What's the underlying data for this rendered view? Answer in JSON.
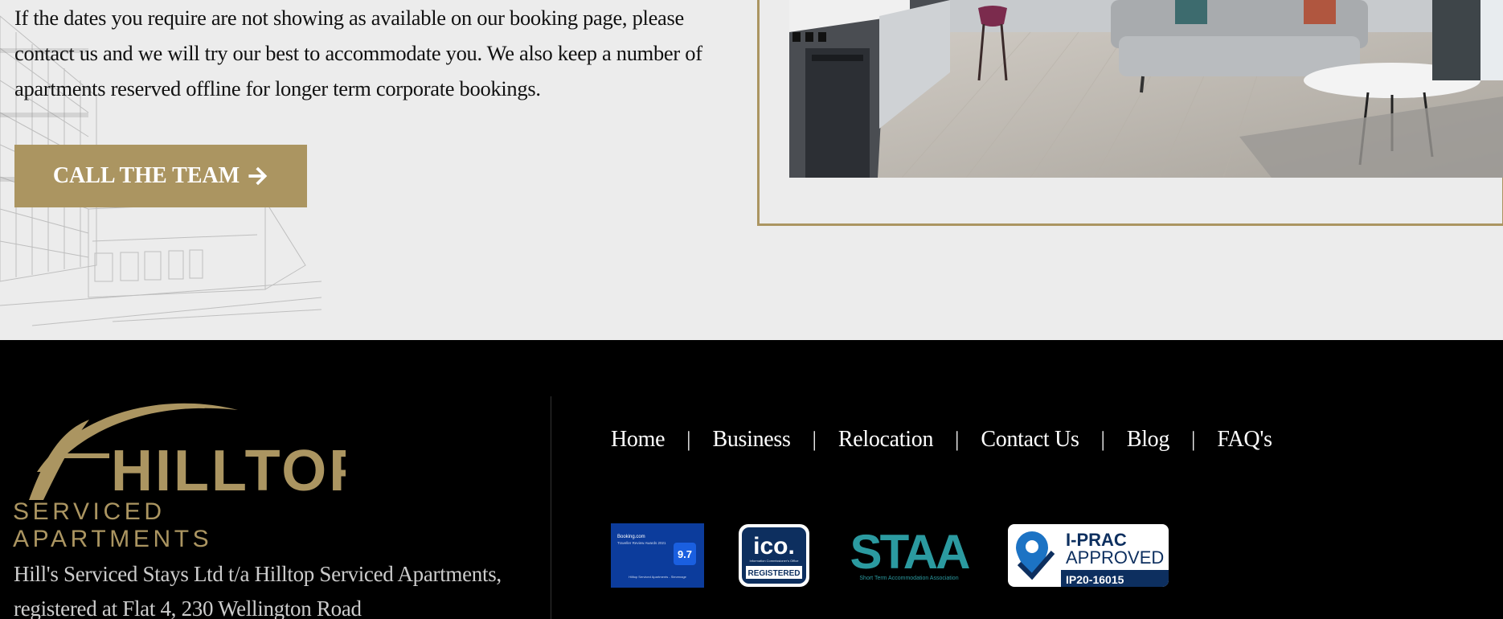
{
  "intro": {
    "text": "If the dates you require are not showing as available on our booking page, please contact us and we will try our best to accommodate you. We also keep a number of apartments reserved offline for longer term corporate bookings."
  },
  "cta": {
    "label": "CALL THE TEAM"
  },
  "colors": {
    "gold": "#ab9561",
    "footer_bg": "#000000",
    "page_bg": "#ececec"
  },
  "footer": {
    "logo": {
      "wordmark": "HILLTOP",
      "tagline": "SERVICED APARTMENTS"
    },
    "company_text": "Hill's Serviced Stays Ltd t/a Hilltop Serviced Apartments, registered at Flat 4, 230 Wellington Road",
    "nav": [
      {
        "label": "Home"
      },
      {
        "label": "Business"
      },
      {
        "label": "Relocation"
      },
      {
        "label": "Contact Us"
      },
      {
        "label": "Blog"
      },
      {
        "label": "FAQ's"
      }
    ],
    "nav_separator": "|",
    "badges": {
      "booking": {
        "line1": "Booking.com",
        "line2": "Traveller Review Awards 2021",
        "score": "9.7",
        "caption": "Hilltop Serviced Apartments - Stevenage"
      },
      "ico": {
        "title": "ico.",
        "caption": "Information Commissioner's Office",
        "status": "REGISTERED"
      },
      "stay": {
        "title": "STAA",
        "caption": "Short Term Accommodation Association"
      },
      "iprac": {
        "line1": "I-PRAC",
        "line2": "APPROVED",
        "code": "IP20-16015"
      }
    }
  }
}
